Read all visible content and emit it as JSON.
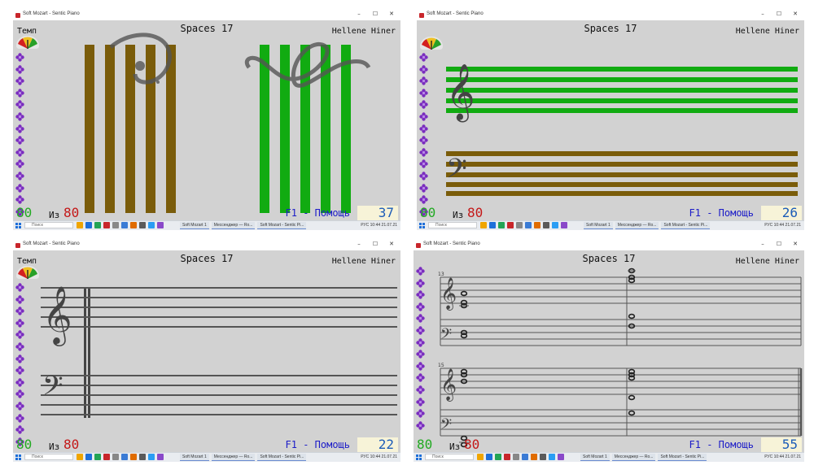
{
  "window_title": "Soft Mozart - Sentic Piano",
  "song_title": "Spaces 17",
  "composer": "Hellene Hiner",
  "tempo_label": "Темп",
  "tempo_value": "80",
  "of_label": "Из",
  "of_value": "80",
  "help_text": "F1 - Помощь",
  "window_buttons": [
    "–",
    "☐",
    "✕"
  ],
  "panels": [
    {
      "id": "p1",
      "counter": "37",
      "view": "vertical-bars",
      "show_tempo_label": true
    },
    {
      "id": "p2",
      "counter": "26",
      "view": "horizontal-staves",
      "show_tempo_label": false
    },
    {
      "id": "p3",
      "counter": "22",
      "view": "grand-staff",
      "show_tempo_label": true
    },
    {
      "id": "p4",
      "counter": "55",
      "view": "score",
      "show_tempo_label": false
    }
  ],
  "score": {
    "measure_numbers": [
      "13",
      "15"
    ]
  },
  "taskbar": {
    "search_placeholder": "Поиск",
    "windows": [
      "Soft Mozart 1",
      "Мессенджер — Ro...",
      "Soft Mozart - Sentic Pi..."
    ],
    "tray": "РУС  10:44  21.07.21"
  },
  "colors": {
    "brown_bar": "#7a5c0a",
    "green_bar": "#11ab11",
    "flower": "#7a2dbf",
    "tempo_green": "#22aa22",
    "count_red": "#c41818",
    "help_blue": "#1c1cc8",
    "counter_bg": "#f7f3d8",
    "counter_text": "#1c5cb8"
  },
  "icons": {
    "tempo_gauge": "tempo-gauge-icon",
    "sidebar_item": "flower-icon",
    "treble_clef": "treble-clef-icon",
    "bass_clef": "bass-clef-icon"
  }
}
